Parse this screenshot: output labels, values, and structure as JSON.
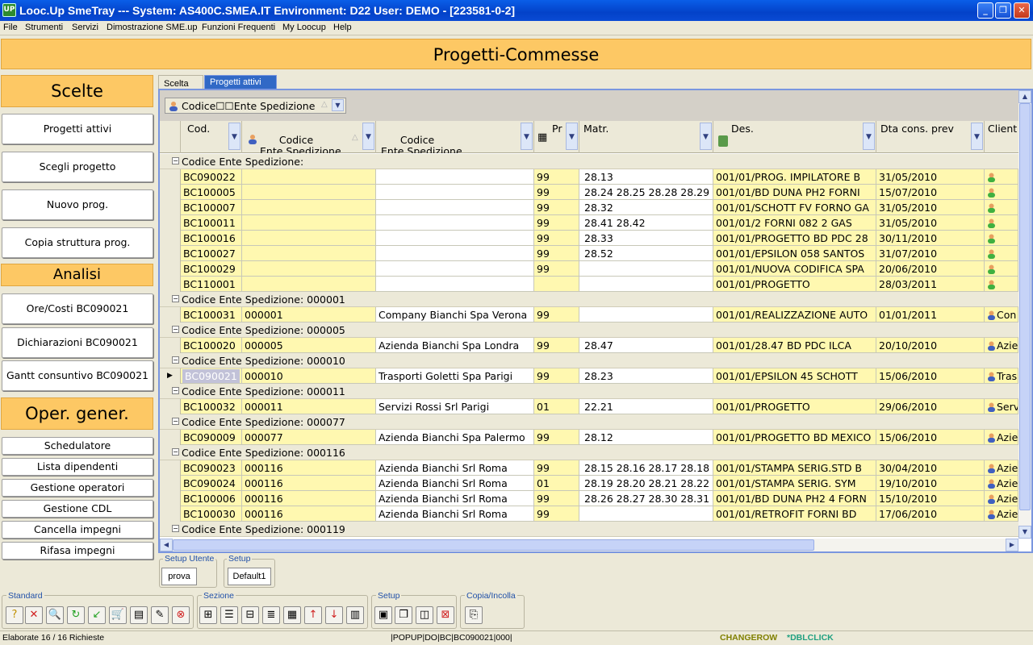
{
  "window": {
    "title": "Looc.Up SmeTray --- System: AS400C.SMEA.IT Environment: D22 User: DEMO - [223581-0-2]",
    "app_icon": "UP"
  },
  "menu": [
    "File",
    "Strumenti",
    "Servizi",
    "Dimostrazione SME.up",
    "Funzioni Frequenti",
    "My Loocup",
    "Help"
  ],
  "header": "Progetti-Commesse",
  "left": {
    "scelte_title": "Scelte",
    "scelte": [
      "Progetti attivi",
      "Scegli progetto",
      "Nuovo prog.",
      "Copia struttura prog."
    ],
    "analisi_title": "Analisi",
    "analisi": [
      "Ore/Costi BC090021",
      "Dichiarazioni BC090021",
      "Gantt consuntivo BC090021"
    ],
    "oper_title": "Oper. gener.",
    "oper": [
      "Schedulatore",
      "Lista dipendenti",
      "Gestione operatori",
      "Gestione CDL",
      "Cancella impegni",
      "Rifasa impegni"
    ]
  },
  "tabs": [
    "Scelta",
    "Progetti attivi"
  ],
  "grid": {
    "group_chip": "Codice☐☐Ente Spedizione",
    "columns": [
      "Cod.",
      "Codice\nEnte Spedizione",
      "Codice\nEnte Spedizione",
      "Pr",
      "Matr.",
      "Des.",
      "Dta cons. prev",
      "Client"
    ],
    "groups": [
      {
        "label": "Codice Ente Spedizione:",
        "rows": [
          [
            "BC090022",
            "",
            "",
            "99",
            "28.13",
            "001/01/PROG. IMPILATORE B",
            "31/05/2010",
            ""
          ],
          [
            "BC100005",
            "",
            "",
            "99",
            "28.24 28.25 28.28 28.29",
            "001/01/BD DUNA PH2 FORNI",
            "15/07/2010",
            ""
          ],
          [
            "BC100007",
            "",
            "",
            "99",
            "28.32",
            "001/01/SCHOTT FV FORNO GA",
            "31/05/2010",
            ""
          ],
          [
            "BC100011",
            "",
            "",
            "99",
            "28.41 28.42",
            "001/01/2 FORNI 082 2 GAS",
            "31/05/2010",
            ""
          ],
          [
            "BC100016",
            "",
            "",
            "99",
            "28.33",
            "001/01/PROGETTO BD PDC 28",
            "30/11/2010",
            ""
          ],
          [
            "BC100027",
            "",
            "",
            "99",
            "28.52",
            "001/01/EPSILON 058 SANTOS",
            "31/07/2010",
            ""
          ],
          [
            "BC100029",
            "",
            "",
            "99",
            "",
            "001/01/NUOVA CODIFICA SPA",
            "20/06/2010",
            ""
          ],
          [
            "BC110001",
            "",
            "",
            "",
            "",
            "001/01/PROGETTO",
            "28/03/2011",
            ""
          ]
        ]
      },
      {
        "label": "Codice Ente Spedizione: 000001",
        "rows": [
          [
            "BC100031",
            "000001",
            "Company Bianchi Spa Verona",
            "99",
            "",
            "001/01/REALIZZAZIONE AUTO",
            "01/01/2011",
            "Con"
          ]
        ]
      },
      {
        "label": "Codice Ente Spedizione: 000005",
        "rows": [
          [
            "BC100020",
            "000005",
            "Azienda Bianchi Spa Londra",
            "99",
            "28.47",
            "001/01/28.47 BD PDC ILCA",
            "20/10/2010",
            "Azie"
          ]
        ]
      },
      {
        "label": "Codice Ente Spedizione: 000010",
        "rows": [
          [
            "BC090021",
            "000010",
            "Trasporti Goletti Spa Parigi",
            "99",
            "28.23",
            "001/01/EPSILON 45 SCHOTT",
            "15/06/2010",
            "Tras"
          ]
        ]
      },
      {
        "label": "Codice Ente Spedizione: 000011",
        "rows": [
          [
            "BC100032",
            "000011",
            "Servizi Rossi Srl Parigi",
            "01",
            "22.21",
            "001/01/PROGETTO",
            "29/06/2010",
            "Serv"
          ]
        ]
      },
      {
        "label": "Codice Ente Spedizione: 000077",
        "rows": [
          [
            "BC090009",
            "000077",
            "Azienda Bianchi Spa Palermo",
            "99",
            "28.12",
            "001/01/PROGETTO BD MEXICO",
            "15/06/2010",
            "Azie"
          ]
        ]
      },
      {
        "label": "Codice Ente Spedizione: 000116",
        "rows": [
          [
            "BC090023",
            "000116",
            "Azienda Bianchi Srl Roma",
            "99",
            "28.15 28.16 28.17 28.18",
            "001/01/STAMPA SERIG.STD B",
            "30/04/2010",
            "Azie"
          ],
          [
            "BC090024",
            "000116",
            "Azienda Bianchi Srl Roma",
            "01",
            "28.19 28.20 28.21 28.22",
            "001/01/STAMPA SERIG. SYM",
            "19/10/2010",
            "Azie"
          ],
          [
            "BC100006",
            "000116",
            "Azienda Bianchi Srl Roma",
            "99",
            "28.26 28.27 28.30 28.31",
            "001/01/BD DUNA PH2 4 FORN",
            "15/10/2010",
            "Azie"
          ],
          [
            "BC100030",
            "000116",
            "Azienda Bianchi Srl Roma",
            "99",
            "",
            "001/01/RETROFIT  FORNI BD",
            "17/06/2010",
            "Azie"
          ]
        ]
      },
      {
        "label": "Codice Ente Spedizione: 000119",
        "rows": []
      }
    ],
    "selected_code": "BC090021"
  },
  "setup": {
    "utente_label": "Setup Utente",
    "utente_btn": "prova",
    "setup_label": "Setup",
    "setup_btn": "Default1"
  },
  "toolbar": {
    "standard": "Standard",
    "sezione": "Sezione",
    "setup": "Setup",
    "copia": "Copia/Incolla"
  },
  "status": {
    "left": "Elaborate 16 / 16 Richieste",
    "mid": "|POPUP|DO|BC|BC090021|000|",
    "changerow": "CHANGEROW",
    "dblclick": "*DBLCLICK"
  }
}
